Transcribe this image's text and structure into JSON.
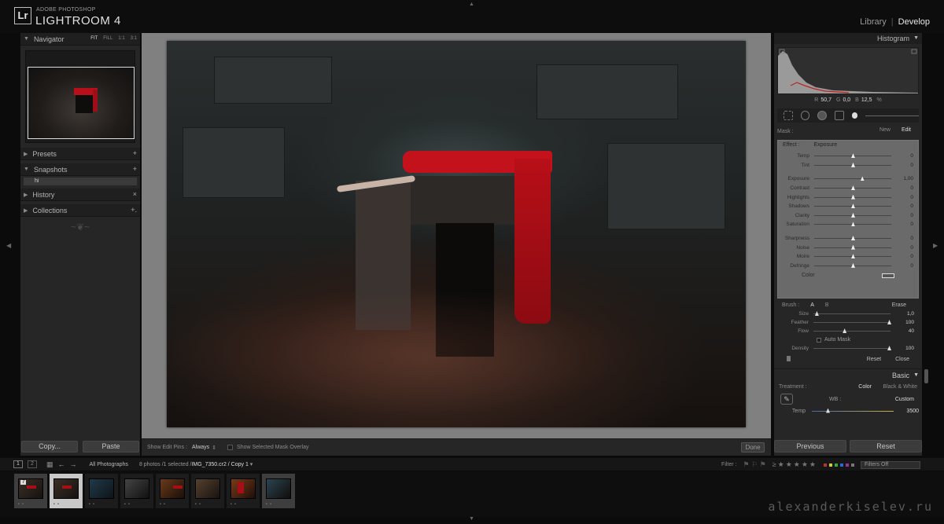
{
  "app": {
    "logo": "Lr",
    "subtitle": "ADOBE PHOTOSHOP",
    "name": "LIGHTROOM 4",
    "modules": [
      "Library",
      "Develop"
    ],
    "active_module": "Develop"
  },
  "left_panel": {
    "navigator": {
      "title": "Navigator",
      "modes": [
        "FIT",
        "FILL",
        "1:1",
        "3:1"
      ]
    },
    "sections": [
      {
        "title": "Presets",
        "action": "+"
      },
      {
        "title": "Snapshots",
        "action": "+"
      },
      {
        "title": "History",
        "action": "×"
      },
      {
        "title": "Collections",
        "action": "+."
      }
    ],
    "snapshot_item": "hi",
    "copy_button": "Copy...",
    "paste_button": "Paste"
  },
  "center": {
    "toolbar": {
      "edit_pins_label": "Show Edit Pins :",
      "edit_pins_value": "Always",
      "mask_overlay_label": "Show Selected Mask Overlay",
      "done_button": "Done"
    }
  },
  "right_panel": {
    "histogram": {
      "title": "Histogram",
      "readout": {
        "r_label": "R",
        "r": "50,7",
        "g_label": "G",
        "g": "0,0",
        "b_label": "B",
        "b": "12,5",
        "unit": "%"
      }
    },
    "mask": {
      "label": "Mask :",
      "new": "New",
      "edit": "Edit"
    },
    "effect": {
      "label": "Effect :",
      "value": "Exposure"
    },
    "sliders_group1": [
      {
        "label": "Temp",
        "value": "0",
        "pos": 0.5
      },
      {
        "label": "Tint",
        "value": "0",
        "pos": 0.5
      }
    ],
    "sliders_group2": [
      {
        "label": "Exposure",
        "value": "1,00",
        "pos": 0.62
      },
      {
        "label": "Contrast",
        "value": "0",
        "pos": 0.5
      },
      {
        "label": "Highlights",
        "value": "0",
        "pos": 0.5
      },
      {
        "label": "Shadows",
        "value": "0",
        "pos": 0.5
      },
      {
        "label": "Clarity",
        "value": "0",
        "pos": 0.5
      },
      {
        "label": "Saturation",
        "value": "0",
        "pos": 0.5
      }
    ],
    "sliders_group3": [
      {
        "label": "Sharpness",
        "value": "0",
        "pos": 0.5
      },
      {
        "label": "Noise",
        "value": "0",
        "pos": 0.5
      },
      {
        "label": "Moire",
        "value": "0",
        "pos": 0.5
      },
      {
        "label": "Defringe",
        "value": "0",
        "pos": 0.5
      }
    ],
    "color_label": "Color",
    "brush": {
      "label": "Brush :",
      "a": "A",
      "b": "B",
      "erase": "Erase",
      "size": {
        "label": "Size",
        "value": "1,0",
        "pos": 0.04
      },
      "feather": {
        "label": "Feather",
        "value": "100",
        "pos": 0.98
      },
      "flow": {
        "label": "Flow",
        "value": "40",
        "pos": 0.4
      },
      "auto_mask": "Auto Mask",
      "density": {
        "label": "Density",
        "value": "100",
        "pos": 0.98
      }
    },
    "reset": "Reset",
    "close": "Close",
    "basic": {
      "title": "Basic",
      "treatment_label": "Treatment :",
      "color": "Color",
      "bw": "Black & White",
      "wb_label": "WB :",
      "wb_value": "Custom",
      "temp_label": "Temp",
      "temp_value": "3500"
    },
    "previous_button": "Previous",
    "reset_button": "Reset"
  },
  "filmstrip_bar": {
    "monitor1": "1",
    "monitor2": "2",
    "source": "All Photographs",
    "info_prefix": "8 photos /1 selected /",
    "info_file": "IMG_7350.cr2 / Copy 1",
    "filter_label": "Filter :",
    "filters_off": "Filters Off"
  },
  "filmstrip": {
    "thumb_badge": "7"
  },
  "watermark": "alexanderkiselev.ru",
  "colors": {
    "accent_red": "#c4121c",
    "panel_bg": "#262626",
    "canvas_bg": "#808080"
  }
}
